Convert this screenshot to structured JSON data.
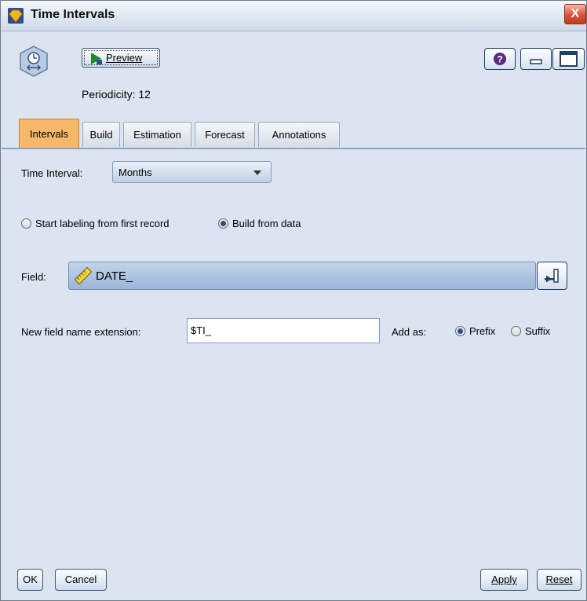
{
  "window": {
    "title": "Time Intervals",
    "close_label": "X"
  },
  "toolbar": {
    "preview_label": "Preview",
    "periodicity": "Periodicity: 12"
  },
  "tabs": [
    {
      "label": "Intervals",
      "active": true
    },
    {
      "label": "Build",
      "active": false
    },
    {
      "label": "Estimation",
      "active": false
    },
    {
      "label": "Forecast",
      "active": false
    },
    {
      "label": "Annotations",
      "active": false
    }
  ],
  "intervals": {
    "time_interval_label": "Time Interval:",
    "time_interval_value": "Months",
    "label_mode_options": [
      {
        "label": "Start labeling from first record",
        "selected": false
      },
      {
        "label": "Build from data",
        "selected": true
      }
    ],
    "field_label": "Field:",
    "field_value": "DATE_",
    "extension_label": "New field name extension:",
    "extension_value": "$TI_",
    "add_as_label": "Add as:",
    "add_as_options": [
      {
        "label": "Prefix",
        "selected": true
      },
      {
        "label": "Suffix",
        "selected": false
      }
    ]
  },
  "footer": {
    "ok": "OK",
    "cancel": "Cancel",
    "apply": "Apply",
    "reset": "Reset"
  },
  "icons": [
    "app-diamond-icon",
    "time-intervals-node-icon",
    "play-icon",
    "help-icon",
    "minimize-icon",
    "maximize-icon",
    "ruler-icon",
    "field-picker-icon"
  ],
  "colors": {
    "accent_tab": "#f7b86a",
    "panel_bg": "#dbe4f0",
    "field_bg": "#a9c2e0"
  }
}
